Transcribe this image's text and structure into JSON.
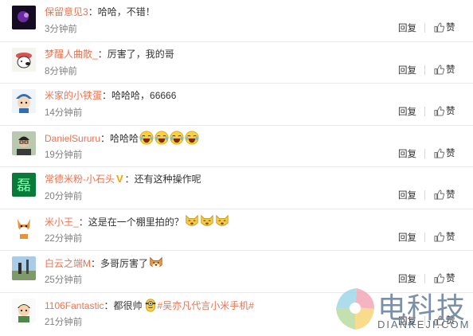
{
  "comments": [
    {
      "user": "保留意见3",
      "text": "：哈哈，不错！",
      "time": "3分钟前",
      "avatar": "purple-dark",
      "emoji": 0
    },
    {
      "user": "梦醒人曲散_",
      "text": "：厉害了，我的哥",
      "time": "8分钟前",
      "avatar": "snoopy",
      "emoji": 0
    },
    {
      "user": "米家的小铁蛋",
      "text": "：哈哈哈，66666",
      "time": "14分钟前",
      "avatar": "cartoon-boy",
      "emoji": 0
    },
    {
      "user": "DanielSururu",
      "text": "：哈哈哈",
      "time": "19分钟前",
      "avatar": "photo-man",
      "emoji": 4,
      "emoji_type": "laugh"
    },
    {
      "user": "常德米粉-小石头",
      "badge": "V",
      "text": "：还有这种操作呢",
      "time": "20分钟前",
      "avatar": "green-glyph",
      "avatar_glyph": "磊",
      "emoji": 0
    },
    {
      "user": "米小王_",
      "text": "：这是在一个棚里拍的？",
      "time": "22分钟前",
      "avatar": "fox",
      "emoji": 3,
      "emoji_type": "doge"
    },
    {
      "user": "白云之端M",
      "text": "：多哥厉害了",
      "time": "25分钟前",
      "avatar": "landscape",
      "emoji": 1,
      "emoji_type": "shiba"
    },
    {
      "user": "1106Fantastic",
      "text": "：都很帅",
      "topic": "#吴亦凡代言小米手机#",
      "time": "21分钟前",
      "avatar": "cartoon-kid",
      "emoji": 1,
      "emoji_type": "minion"
    }
  ],
  "actions": {
    "reply": "回复",
    "like": "赞"
  },
  "watermark": {
    "title": "电科技",
    "sub": "DIANKEJI.COM"
  },
  "colors": {
    "username": "#eb7350",
    "text": "#333333",
    "time": "#808080"
  }
}
